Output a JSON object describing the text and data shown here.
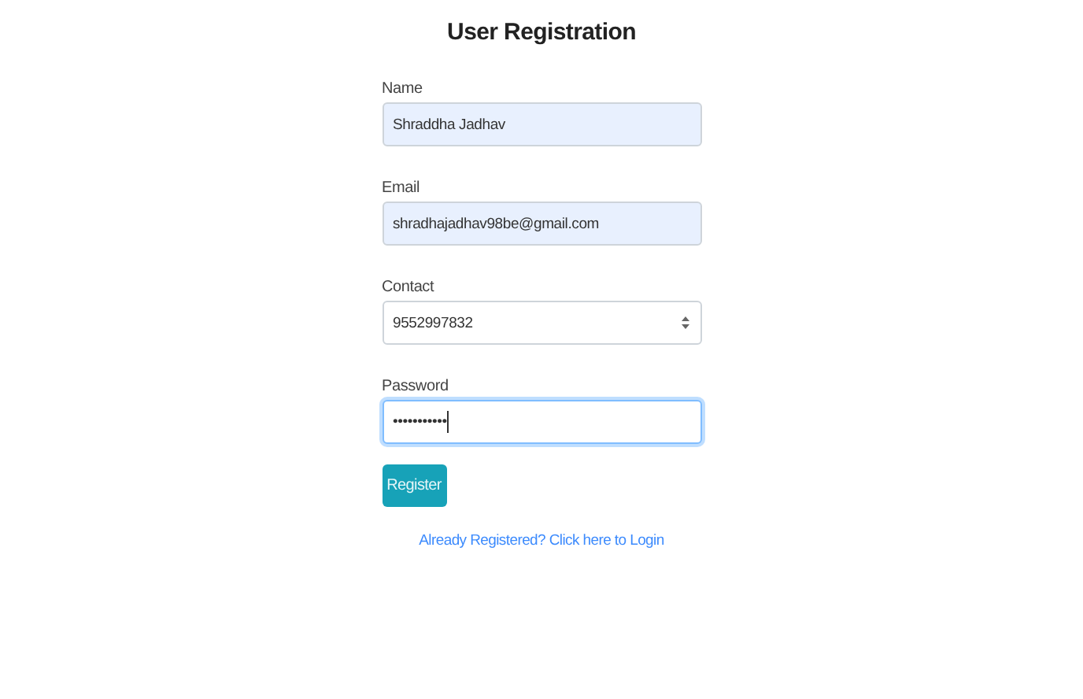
{
  "title": "User Registration",
  "fields": [
    {
      "label": "Name",
      "kind": "text",
      "value": "Shraddha Jadhav",
      "autofilled": true,
      "focused": false
    },
    {
      "label": "Email",
      "kind": "text",
      "value": "shradhajadhav98be@gmail.com",
      "autofilled": true,
      "focused": false
    },
    {
      "label": "Contact",
      "kind": "number",
      "value": "9552997832",
      "autofilled": false,
      "focused": false
    },
    {
      "label": "Password",
      "kind": "password",
      "value": "•••••••••••",
      "autofilled": false,
      "focused": true
    }
  ],
  "button": "Register",
  "link": "Already Registered? Click here to Login"
}
